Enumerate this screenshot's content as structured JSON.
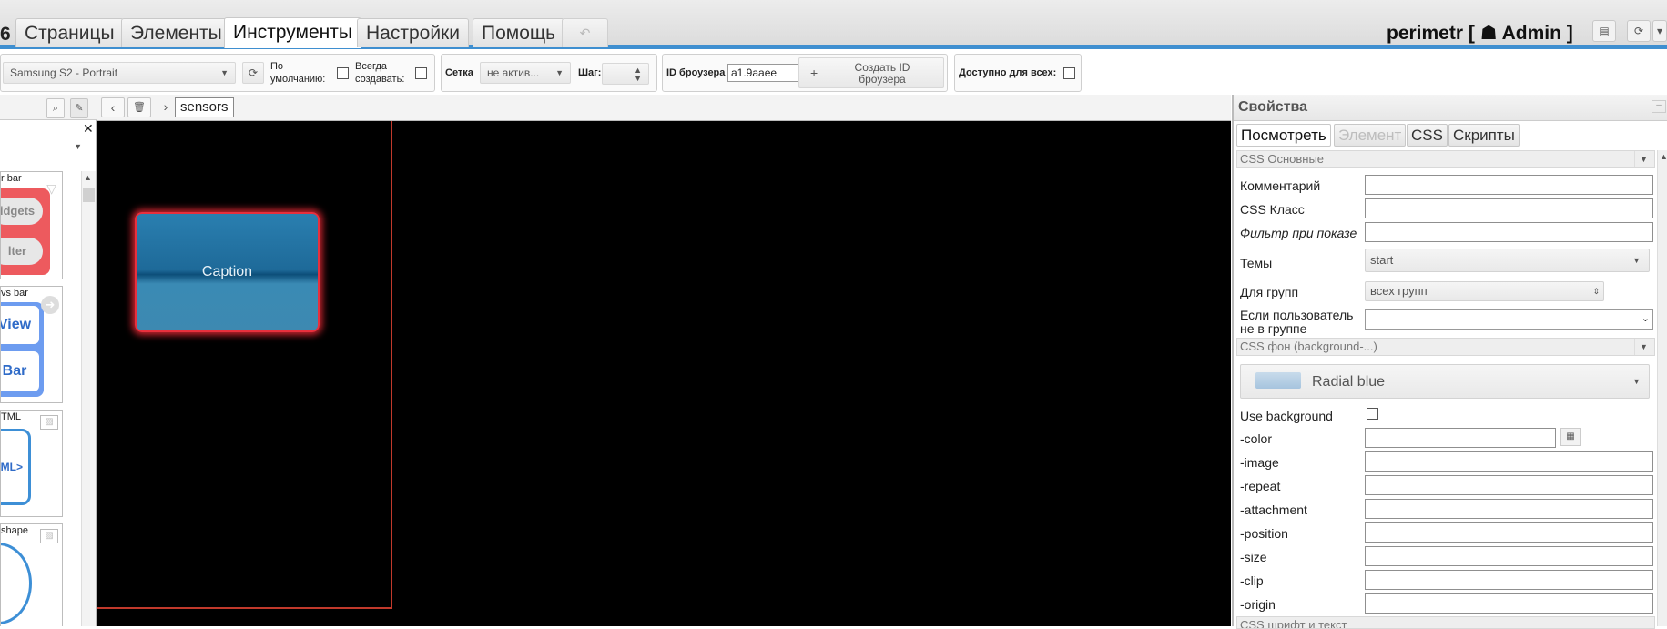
{
  "topbar": {
    "tab_number": "6",
    "tabs": [
      "Страницы",
      "Элементы",
      "Инструменты",
      "Настройки",
      "Помощь"
    ],
    "active_tab": "Инструменты",
    "undo_glyph": "↶",
    "user": "perimetr [ ☗ Admin ]"
  },
  "toolbar": {
    "device_select": "Samsung S2 - Portrait",
    "default_label_1": "По",
    "default_label_2": "умолчанию:",
    "always_create_1": "Всегда",
    "always_create_2": "создавать:",
    "grid_label": "Сетка",
    "grid_value": "не актив...",
    "step_label": "Шаг:",
    "browser_id_label": "ID броузера",
    "browser_id_value": "a1.9aaee",
    "create_id_1": "Создать ID",
    "create_id_2": "броузера",
    "available_all": "Доступно для всех:"
  },
  "palette": {
    "cards": [
      {
        "title": "r bar",
        "items": [
          "idgets",
          "lter"
        ]
      },
      {
        "title": "vs bar",
        "items": [
          "View",
          "Bar"
        ]
      },
      {
        "title": "TML",
        "items": [
          "ML>"
        ]
      },
      {
        "title": "shape",
        "items": []
      }
    ]
  },
  "canvas": {
    "view_name": "sensors",
    "caption": "Caption"
  },
  "props": {
    "title": "Свойства",
    "tabs": [
      "Посмотреть",
      "Элемент",
      "CSS",
      "Скрипты"
    ],
    "section_basic": "CSS Основные",
    "comment_label": "Комментарий",
    "css_class_label": "CSS Класс",
    "filter_label": "Фильтр при показе",
    "themes_label": "Темы",
    "themes_value": "start",
    "groups_label": "Для групп",
    "groups_value": "всех групп",
    "if_user_label_1": "Если пользователь",
    "if_user_label_2": "не в группе",
    "section_background": "CSS фон (background-...)",
    "background_preset": "Radial blue",
    "use_background_label": "Use background",
    "bg_fields": [
      "-color",
      "-image",
      "-repeat",
      "-attachment",
      "-position",
      "-size",
      "-clip",
      "-origin"
    ],
    "section_font": "CSS шрифт и текст"
  },
  "colors": {
    "accent": "#3f8fd0",
    "caption_glow": "#e8303d",
    "caption_fill": "#1e6a99"
  }
}
